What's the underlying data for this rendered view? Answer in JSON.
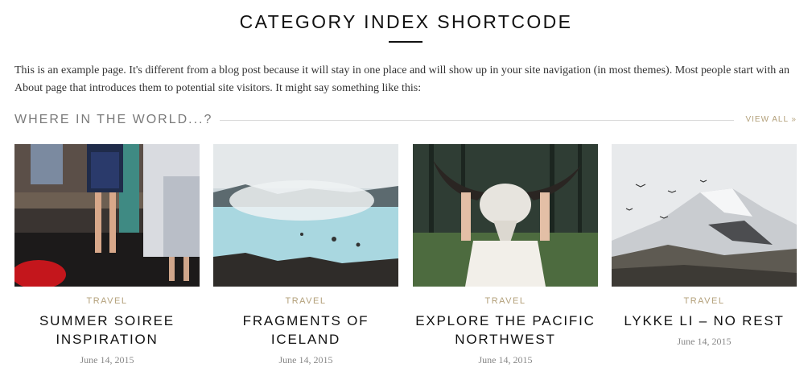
{
  "page": {
    "title": "CATEGORY INDEX SHORTCODE",
    "intro": "This is an example page. It's different from a blog post because it will stay in one place and will show up in your site navigation (in most themes). Most people start with an About page that introduces them to potential site visitors. It might say something like this:"
  },
  "section": {
    "title": "WHERE IN THE WORLD...?",
    "view_all": "VIEW ALL »"
  },
  "posts": [
    {
      "category": "TRAVEL",
      "title": "SUMMER SOIREE INSPIRATION",
      "date": "June 14, 2015"
    },
    {
      "category": "TRAVEL",
      "title": "FRAGMENTS OF ICELAND",
      "date": "June 14, 2015"
    },
    {
      "category": "TRAVEL",
      "title": "EXPLORE THE PACIFIC NORTHWEST",
      "date": "June 14, 2015"
    },
    {
      "category": "TRAVEL",
      "title": "LYKKE LI – NO REST",
      "date": "June 14, 2015"
    }
  ],
  "colors": {
    "accent": "#b3a07a",
    "section_title": "#7a7a7a",
    "heading": "#111111"
  }
}
